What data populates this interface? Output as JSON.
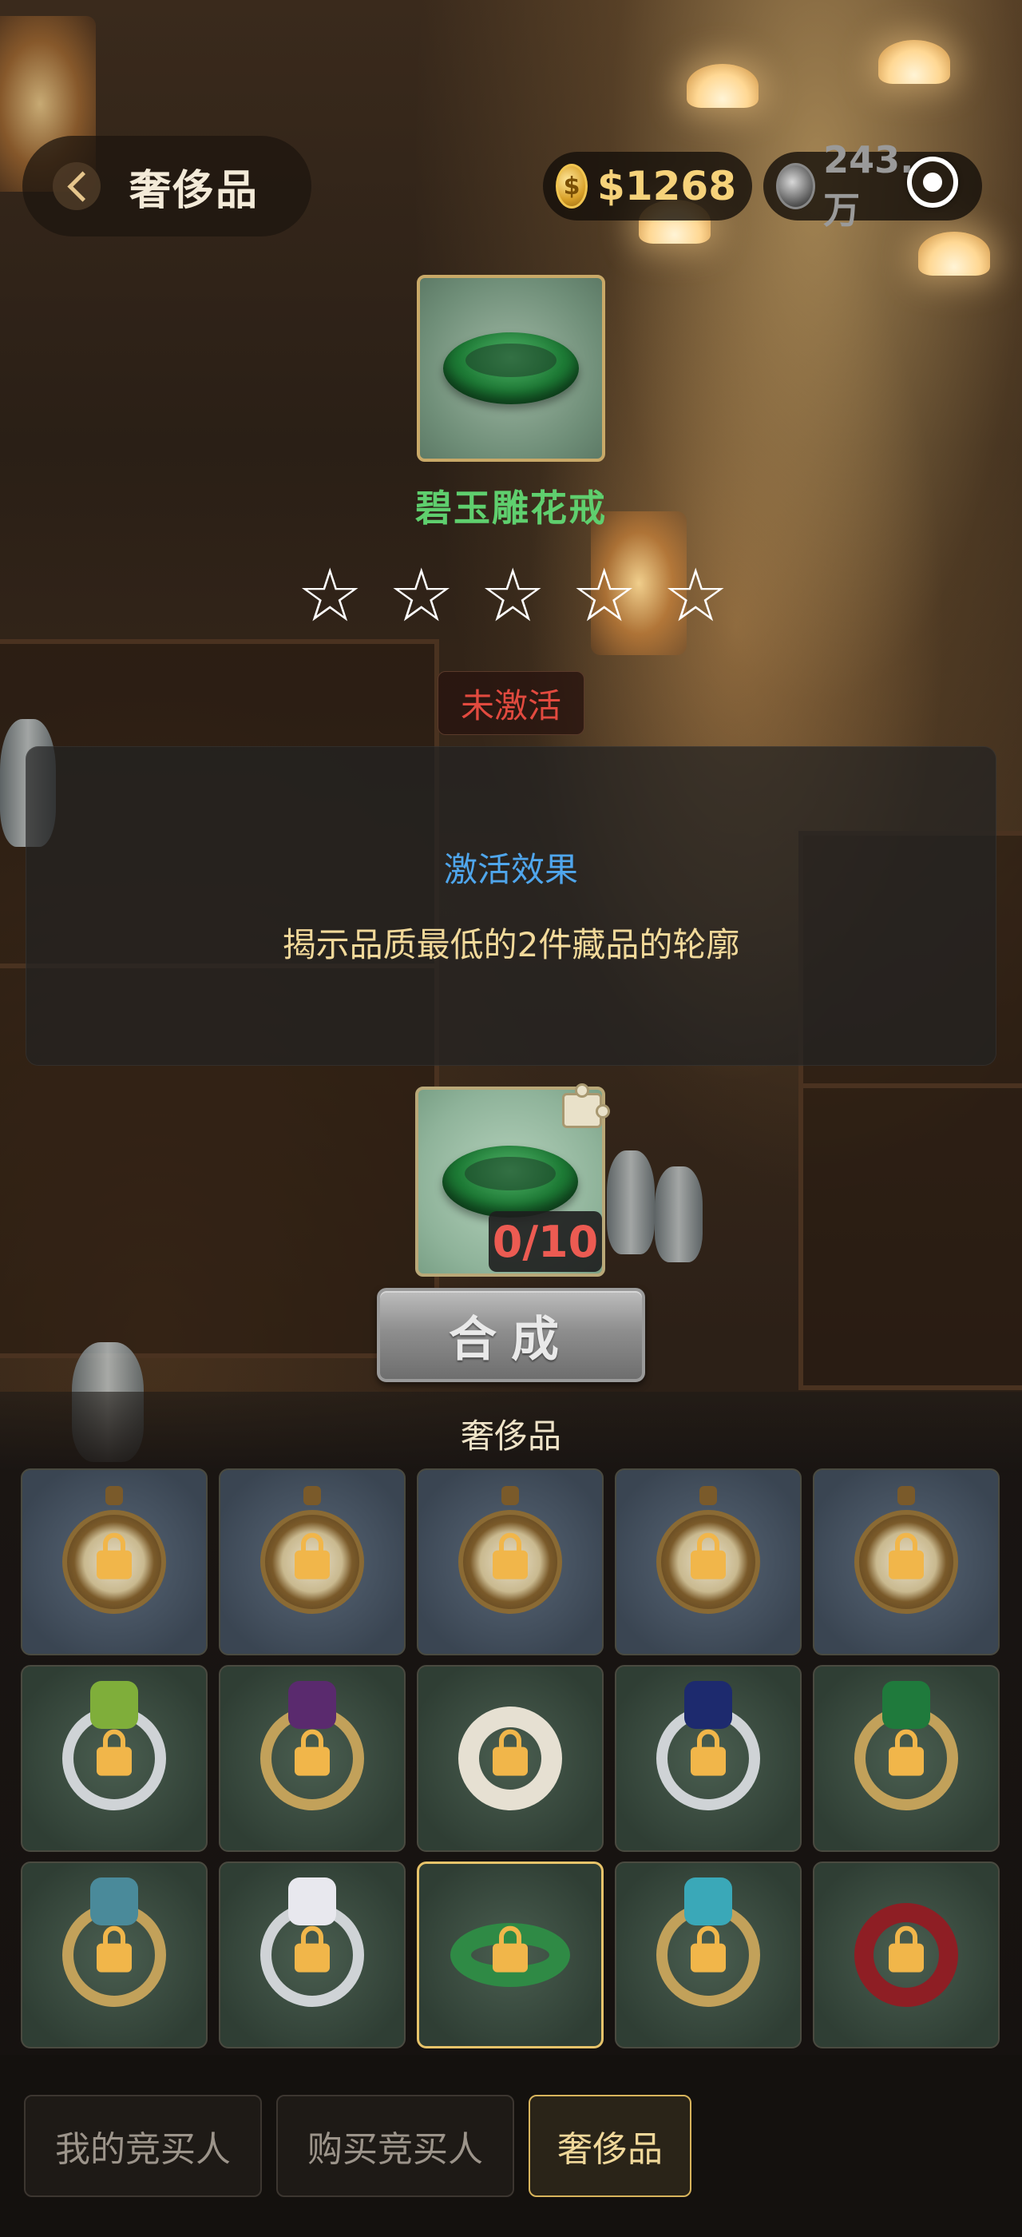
{
  "header": {
    "title": "奢侈品",
    "money": "$1268",
    "coin_symbol": "$",
    "gems": "243.",
    "gems_suffix": "万"
  },
  "hero": {
    "name": "碧玉雕花戒",
    "stars_total": 5,
    "stars_filled": 0,
    "star_glyph": "☆",
    "status": "未激活"
  },
  "effect": {
    "title": "激活效果",
    "description": "揭示品质最低的2件藏品的轮廓"
  },
  "craft": {
    "fragments": "0/10",
    "button_label": "合成"
  },
  "collection": {
    "title": "奢侈品",
    "items": [
      {
        "kind": "watch",
        "theme": "blue",
        "locked": true
      },
      {
        "kind": "watch",
        "theme": "blue",
        "locked": true
      },
      {
        "kind": "watch",
        "theme": "blue",
        "locked": true
      },
      {
        "kind": "watch",
        "theme": "blue",
        "locked": true
      },
      {
        "kind": "watch",
        "theme": "blue",
        "locked": true
      },
      {
        "kind": "ring",
        "variant": "silver",
        "gem_color": "#7fae3a",
        "theme": "green",
        "locked": true
      },
      {
        "kind": "ring",
        "variant": "gold",
        "gem_color": "#5a2a6e",
        "theme": "green",
        "locked": true
      },
      {
        "kind": "ring",
        "variant": "white",
        "gem_color": "",
        "theme": "green",
        "locked": true
      },
      {
        "kind": "ring",
        "variant": "silver",
        "gem_color": "#1d2a6e",
        "theme": "green",
        "locked": true
      },
      {
        "kind": "ring",
        "variant": "gold",
        "gem_color": "#1f7a3c",
        "theme": "green",
        "locked": true
      },
      {
        "kind": "ring",
        "variant": "gold",
        "gem_color": "#4a8a9a",
        "theme": "green",
        "locked": true
      },
      {
        "kind": "ring",
        "variant": "silver",
        "gem_color": "#e8e8ee",
        "theme": "green",
        "locked": true
      },
      {
        "kind": "ring",
        "variant": "jade",
        "gem_color": "",
        "theme": "green",
        "locked": true,
        "selected": true
      },
      {
        "kind": "ring",
        "variant": "gold",
        "gem_color": "#3aa8b8",
        "theme": "green",
        "locked": true
      },
      {
        "kind": "ring",
        "variant": "red",
        "gem_color": "",
        "theme": "green",
        "locked": true
      }
    ]
  },
  "bottom_nav": {
    "tabs": [
      {
        "label": "我的竞买人",
        "active": false
      },
      {
        "label": "购买竞买人",
        "active": false
      },
      {
        "label": "奢侈品",
        "active": true
      }
    ]
  },
  "colors": {
    "item_name": "#5fcf6e",
    "status_inactive": "#e24a3f",
    "effect_title": "#4fa6ec",
    "effect_desc": "#f2d99a",
    "fragment_count": "#ec5b52",
    "money": "#f6d27a",
    "active_tab_border": "#d8b45c",
    "lock": "#f1b64a"
  }
}
